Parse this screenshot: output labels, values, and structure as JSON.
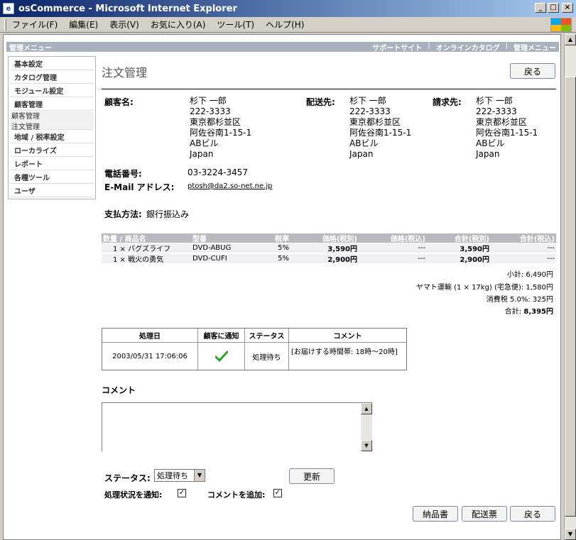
{
  "window": {
    "title": "osCommerce - Microsoft Internet Explorer",
    "icon": "ie-page-icon"
  },
  "menubar": {
    "items": [
      "ファイル(F)",
      "編集(E)",
      "表示(V)",
      "お気に入り(A)",
      "ツール(T)",
      "ヘルプ(H)"
    ]
  },
  "topnav": {
    "left": "管理メニュー",
    "links": [
      "サポートサイト",
      "オンラインカタログ",
      "管理メニュー"
    ]
  },
  "sidebar": {
    "items": [
      "基本設定",
      "カタログ管理",
      "モジュール設定",
      "顧客管理"
    ],
    "sub": [
      "顧客管理",
      "注文管理"
    ],
    "items2": [
      "地域 / 税率設定",
      "ローカライズ",
      "レポート",
      "各種ツール",
      "ユーザ"
    ]
  },
  "page": {
    "title": "注文管理",
    "back_label": "戻る"
  },
  "customer": {
    "label": "顧客名:",
    "lines": [
      "杉下 一郎",
      "222-3333",
      "東京都杉並区",
      "阿佐谷南1-15-1",
      "ABビル",
      "Japan"
    ]
  },
  "delivery": {
    "label": "配送先:",
    "lines": [
      "杉下 一郎",
      "222-3333",
      "東京都杉並区",
      "阿佐谷南1-15-1",
      "ABビル",
      "Japan"
    ]
  },
  "billing": {
    "label": "請求先:",
    "lines": [
      "杉下 一郎",
      "222-3333",
      "東京都杉並区",
      "阿佐谷南1-15-1",
      "ABビル",
      "Japan"
    ]
  },
  "phone": {
    "label": "電話番号:",
    "value": "03-3224-3457"
  },
  "email": {
    "label": "E-Mail アドレス:",
    "value": "ptosh@da2.so-net.ne.jp"
  },
  "payment": {
    "label": "支払方法:",
    "value": "銀行振込み"
  },
  "products": {
    "headers": [
      "数量 / 商品名",
      "型番",
      "税率",
      "価格(税別)",
      "価格(税込)",
      "合計(税別)",
      "合計(税込)"
    ],
    "rows": [
      {
        "qty_name": "1 × バグズライフ",
        "model": "DVD-ABUG",
        "tax": "5%",
        "price_ex": "3,590円",
        "price_in": "---",
        "total_ex": "3,590円",
        "total_in": "---"
      },
      {
        "qty_name": "1 × 戦火の勇気",
        "model": "DVD-CUFI",
        "tax": "5%",
        "price_ex": "2,900円",
        "price_in": "---",
        "total_ex": "2,900円",
        "total_in": "---"
      }
    ]
  },
  "totals": {
    "subtotal": "小計: 6,490円",
    "shipping": "ヤマト運輸 (1 × 17kg) (宅急便): 1,580円",
    "tax": "消費税 5.0%:   325円",
    "total_label": "合計:",
    "total_value": "8,395円"
  },
  "history": {
    "headers": [
      "処理日",
      "顧客に通知",
      "ステータス",
      "コメント"
    ],
    "row": {
      "date": "2003/05/31 17:06:06",
      "status": "処理待ち",
      "comment": "[お届けする時間帯: 18時～20時]"
    }
  },
  "comment": {
    "label": "コメント"
  },
  "status": {
    "label": "ステータス:",
    "selected": "処理待ち",
    "update_label": "更新"
  },
  "notify": {
    "label": "処理状況を通知:",
    "checked": "✓"
  },
  "append": {
    "label": "コメントを追加:",
    "checked": "✓"
  },
  "bottom_buttons": {
    "invoice": "納品書",
    "packing": "配送票",
    "back": "戻る"
  },
  "colors": {
    "title_start": "#0a246a",
    "nav": "#a9b1bd",
    "check": "#2aa52a"
  }
}
